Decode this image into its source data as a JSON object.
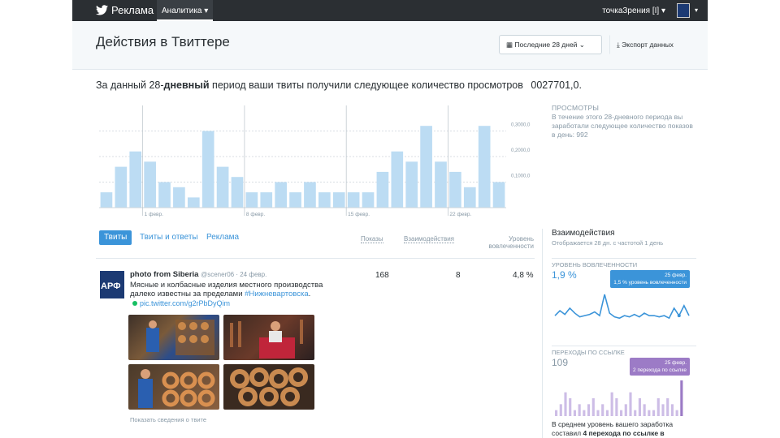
{
  "topbar": {
    "brand": "Реклама",
    "nav_analytics": "Аналитика ▾",
    "account": "точкаЗрения [I] ▾"
  },
  "header": {
    "title": "Действия в Твиттере",
    "range_button": "Последние 28 дней ⌄",
    "export_button": "Экспорт данных"
  },
  "summary": {
    "prefix": "За данный 28-",
    "bold": "дневный",
    "suffix": " период ваши твиты получили следующее количество просмотров",
    "value": "0027701,0."
  },
  "side_note": {
    "label": "ПРОСМОТРЫ",
    "text": "В течение этого 28-дневного периода вы заработали следующее количество показов в день: 992"
  },
  "chart_data": {
    "type": "bar",
    "values": [
      3,
      8,
      11,
      9,
      5,
      4,
      2,
      15,
      8,
      6,
      3,
      3,
      5,
      3,
      5,
      3,
      3,
      3,
      3,
      7,
      11,
      9,
      16,
      9,
      7,
      4,
      16,
      5
    ],
    "x_ticks": [
      "1 февр.",
      "8 февр.",
      "15 февр.",
      "22 февр."
    ],
    "y_ticks": [
      "0,3000,0",
      "0,2000,0",
      "0,1000,0"
    ],
    "ylim": [
      0,
      20
    ]
  },
  "tabs": {
    "tweets": "Твиты",
    "tweets_replies": "Твиты и ответы",
    "promoted": "Реклама"
  },
  "columns": {
    "impressions": "Показы",
    "engagements": "Взаимодействия",
    "rate": "Уровень вовлеченности"
  },
  "tweet": {
    "avatar_text": "АРФ",
    "name": "photo from Siberia",
    "handle_date": "@scener06 · 24 февр.",
    "text": "Мясные и колбасные изделия местного производства далеко известны за пределами ",
    "hashtag": "#Нижневартовска",
    "text_end": ".",
    "link": "pic.twitter.com/g2rPbDyQim",
    "impressions": "168",
    "engagements": "8",
    "rate": "4,8 %",
    "footer": "Показать сведения о твите"
  },
  "right": {
    "engage_title": "Взаимодействия",
    "engage_sub": "Отображается 28 дн. с частотой 1 день",
    "rate_card": {
      "label": "Уровень вовлеченности",
      "value": "1,9 %",
      "tooltip_date": "25 февр.",
      "tooltip_text": "1,5 % уровень вовлеченности",
      "color": "#3b94d9",
      "series": [
        0.9,
        1.3,
        1.0,
        1.5,
        1.1,
        0.8,
        0.9,
        1.0,
        1.2,
        0.9,
        2.6,
        1.1,
        0.8,
        0.7,
        0.9,
        0.8,
        1.0,
        0.8,
        1.1,
        0.9,
        0.9,
        0.8,
        0.9,
        0.7,
        1.5,
        0.9,
        1.7,
        0.9
      ]
    },
    "link_card": {
      "label": "Переходы по ссылке",
      "value": "109",
      "tooltip_date": "25 февр.",
      "tooltip_text": "2 перехода по ссылке",
      "color": "#9c7bc6",
      "series": [
        1,
        2,
        4,
        3,
        1,
        2,
        1,
        2,
        3,
        1,
        2,
        1,
        4,
        3,
        1,
        2,
        4,
        1,
        3,
        2,
        1,
        1,
        3,
        2,
        3,
        2,
        1,
        6
      ]
    },
    "bottom_note_prefix": "В среднем уровень вашего заработка составил ",
    "bottom_note_bold": "4 перехода по ссылке в"
  }
}
